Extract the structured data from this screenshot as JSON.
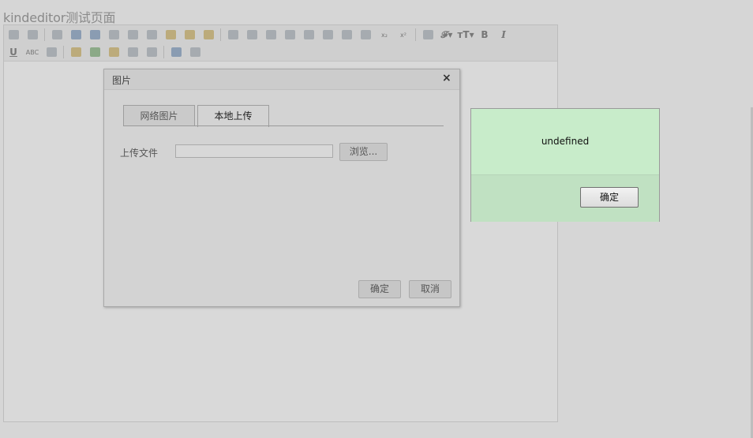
{
  "page": {
    "title": "kindeditor测试页面"
  },
  "toolbar": {
    "row1": [
      {
        "icon": "source-icon",
        "tone": "gray"
      },
      {
        "icon": "preview-icon",
        "tone": "gray"
      },
      {
        "sep": true
      },
      {
        "icon": "template-icon",
        "tone": "gray"
      },
      {
        "icon": "undo-icon",
        "tone": "blue"
      },
      {
        "icon": "redo-icon",
        "tone": "blue"
      },
      {
        "icon": "print-icon",
        "tone": "gray"
      },
      {
        "icon": "cut-icon",
        "tone": "gray"
      },
      {
        "icon": "copy-icon",
        "tone": "gray"
      },
      {
        "icon": "paste-icon",
        "tone": "yellow"
      },
      {
        "icon": "paste-text-icon",
        "tone": "yellow"
      },
      {
        "icon": "paste-word-icon",
        "tone": "yellow"
      },
      {
        "sep": true
      },
      {
        "icon": "align-left-icon",
        "tone": "gray"
      },
      {
        "icon": "align-center-icon",
        "tone": "gray"
      },
      {
        "icon": "align-right-icon",
        "tone": "gray"
      },
      {
        "icon": "align-justify-icon",
        "tone": "gray"
      },
      {
        "icon": "ordered-list-icon",
        "tone": "gray"
      },
      {
        "icon": "unordered-list-icon",
        "tone": "gray"
      },
      {
        "icon": "indent-icon",
        "tone": "gray"
      },
      {
        "icon": "outdent-icon",
        "tone": "gray"
      },
      {
        "icon": "subscript-icon",
        "text": "x₂"
      },
      {
        "icon": "superscript-icon",
        "text": "x²"
      },
      {
        "sep": true
      },
      {
        "icon": "select-all-icon",
        "tone": "gray"
      },
      {
        "icon": "font-name-icon",
        "text": "𝓕▾"
      },
      {
        "icon": "font-size-icon",
        "text": "тT▾"
      },
      {
        "icon": "bold-icon",
        "text": "B"
      },
      {
        "icon": "italic-icon",
        "text": "I"
      }
    ],
    "row2": [
      {
        "icon": "underline-icon",
        "text": "U"
      },
      {
        "icon": "strikethrough-icon",
        "text": "ABC"
      },
      {
        "icon": "clear-format-icon",
        "tone": "gray"
      },
      {
        "sep": true
      },
      {
        "icon": "image-icon",
        "tone": "yellow"
      },
      {
        "icon": "flash-icon",
        "tone": "green"
      },
      {
        "icon": "emoticons-icon",
        "tone": "yellow"
      },
      {
        "icon": "link-icon",
        "tone": "gray"
      },
      {
        "icon": "unlink-icon",
        "tone": "gray"
      },
      {
        "sep": true
      },
      {
        "icon": "about-icon",
        "tone": "blue"
      },
      {
        "icon": "multi-image-icon",
        "tone": "gray"
      }
    ]
  },
  "image_dialog": {
    "title": "图片",
    "close_symbol": "×",
    "tabs": [
      "网络图片",
      "本地上传"
    ],
    "active_tab": "本地上传",
    "upload_label": "上传文件",
    "upload_value": "",
    "browse_label": "浏览...",
    "ok_label": "确定",
    "cancel_label": "取消"
  },
  "alert_dialog": {
    "message": "undefined",
    "ok_label": "确定"
  }
}
